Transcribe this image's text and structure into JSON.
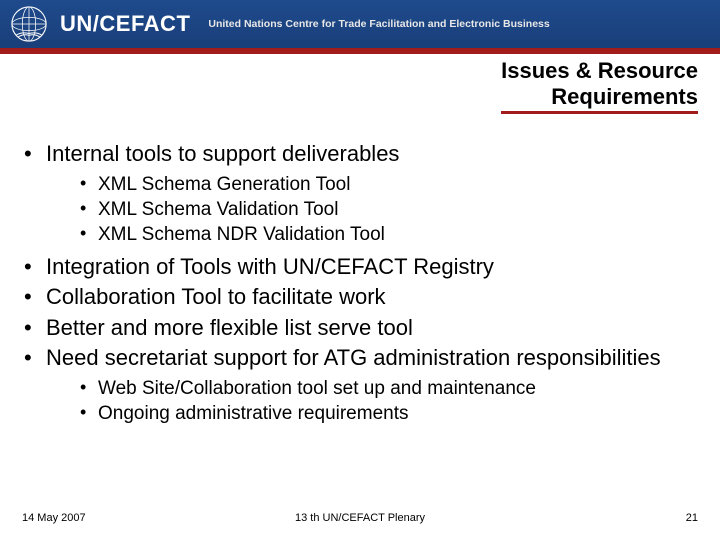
{
  "header": {
    "brand": "UN/CEFACT",
    "subtitle": "United Nations Centre for Trade Facilitation and Electronic Business"
  },
  "title_line1": "Issues & Resource",
  "title_line2": "Requirements",
  "bullets": {
    "b1": "Internal tools to support deliverables",
    "b1_sub": [
      "XML Schema Generation Tool",
      "XML Schema Validation Tool",
      "XML Schema NDR Validation Tool"
    ],
    "b2": "Integration of Tools with UN/CEFACT Registry",
    "b3": "Collaboration Tool to facilitate work",
    "b4": "Better and more flexible list serve tool",
    "b5": "Need secretariat support for ATG administration responsibilities",
    "b5_sub": [
      "Web Site/Collaboration tool set up and maintenance",
      "Ongoing administrative requirements"
    ]
  },
  "footer": {
    "date": "14 May 2007",
    "center": "13 th UN/CEFACT Plenary",
    "page": "21"
  }
}
